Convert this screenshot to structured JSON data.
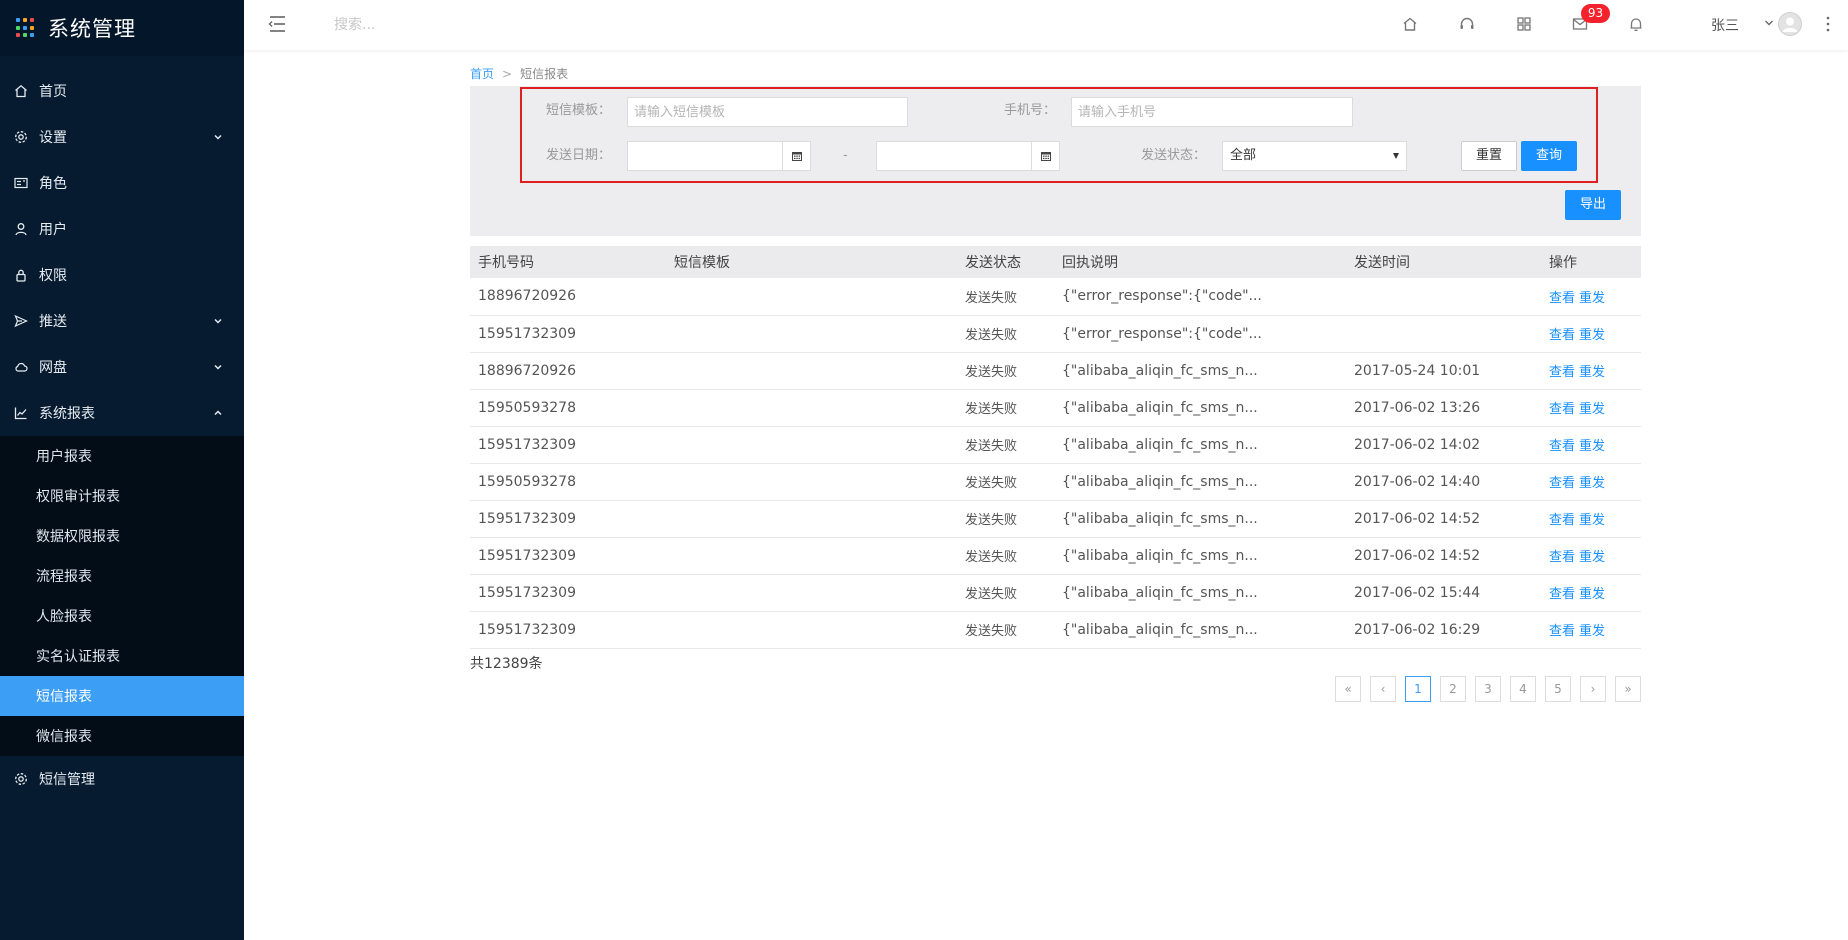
{
  "brand": {
    "title": "系统管理",
    "logo_colors": [
      "#3c9ef5",
      "#f5a623",
      "#e84d4d",
      "#4cd964",
      "#3c9ef5",
      "#f5a623",
      "#e84d4d",
      "#4cd964",
      "#3c9ef5"
    ]
  },
  "sidebar": {
    "items": [
      {
        "label": "首页",
        "icon": "home-icon"
      },
      {
        "label": "设置",
        "icon": "gear-icon",
        "expandable": true
      },
      {
        "label": "角色",
        "icon": "id-card-icon"
      },
      {
        "label": "用户",
        "icon": "user-icon"
      },
      {
        "label": "权限",
        "icon": "lock-icon"
      },
      {
        "label": "推送",
        "icon": "send-icon",
        "expandable": true
      },
      {
        "label": "网盘",
        "icon": "cloud-icon",
        "expandable": true
      },
      {
        "label": "系统报表",
        "icon": "chart-icon",
        "expanded": true
      }
    ],
    "sub_items": [
      "用户报表",
      "权限审计报表",
      "数据权限报表",
      "流程报表",
      "人脸报表",
      "实名认证报表",
      "短信报表",
      "微信报表"
    ],
    "active_sub": "短信报表",
    "after": {
      "label": "短信管理",
      "icon": "gear-icon"
    }
  },
  "topbar": {
    "search_placeholder": "搜索...",
    "mail_badge": "93",
    "user_name": "张三"
  },
  "breadcrumb": {
    "home": "首页",
    "sep": ">",
    "current": "短信报表"
  },
  "filter": {
    "template_label": "短信模板：",
    "template_placeholder": "请输入短信模板",
    "phone_label": "手机号：",
    "phone_placeholder": "请输入手机号",
    "date_label": "发送日期：",
    "date_dash": "-",
    "status_label": "发送状态：",
    "status_value": "全部",
    "reset_label": "重置",
    "query_label": "查询",
    "export_label": "导出"
  },
  "table": {
    "headers": [
      "手机号码",
      "短信模板",
      "发送状态",
      "回执说明",
      "发送时间",
      "操作"
    ],
    "view_label": "查看",
    "resend_label": "重发",
    "rows": [
      {
        "phone": "18896720926",
        "template": "",
        "status": "发送失败",
        "receipt": "{\"error_response\":{\"code\"...",
        "time": ""
      },
      {
        "phone": "15951732309",
        "template": "",
        "status": "发送失败",
        "receipt": "{\"error_response\":{\"code\"...",
        "time": ""
      },
      {
        "phone": "18896720926",
        "template": "",
        "status": "发送失败",
        "receipt": "{\"alibaba_aliqin_fc_sms_n...",
        "time": "2017-05-24 10:01"
      },
      {
        "phone": "15950593278",
        "template": "",
        "status": "发送失败",
        "receipt": "{\"alibaba_aliqin_fc_sms_n...",
        "time": "2017-06-02 13:26"
      },
      {
        "phone": "15951732309",
        "template": "",
        "status": "发送失败",
        "receipt": "{\"alibaba_aliqin_fc_sms_n...",
        "time": "2017-06-02 14:02"
      },
      {
        "phone": "15950593278",
        "template": "",
        "status": "发送失败",
        "receipt": "{\"alibaba_aliqin_fc_sms_n...",
        "time": "2017-06-02 14:40"
      },
      {
        "phone": "15951732309",
        "template": "",
        "status": "发送失败",
        "receipt": "{\"alibaba_aliqin_fc_sms_n...",
        "time": "2017-06-02 14:52"
      },
      {
        "phone": "15951732309",
        "template": "",
        "status": "发送失败",
        "receipt": "{\"alibaba_aliqin_fc_sms_n...",
        "time": "2017-06-02 14:52"
      },
      {
        "phone": "15951732309",
        "template": "",
        "status": "发送失败",
        "receipt": "{\"alibaba_aliqin_fc_sms_n...",
        "time": "2017-06-02 15:44"
      },
      {
        "phone": "15951732309",
        "template": "",
        "status": "发送失败",
        "receipt": "{\"alibaba_aliqin_fc_sms_n...",
        "time": "2017-06-02 16:29"
      }
    ]
  },
  "pagination": {
    "total": "共12389条",
    "first": "«",
    "prev": "‹",
    "pages": [
      "1",
      "2",
      "3",
      "4",
      "5"
    ],
    "current": "1",
    "next": "›",
    "last": "»"
  }
}
